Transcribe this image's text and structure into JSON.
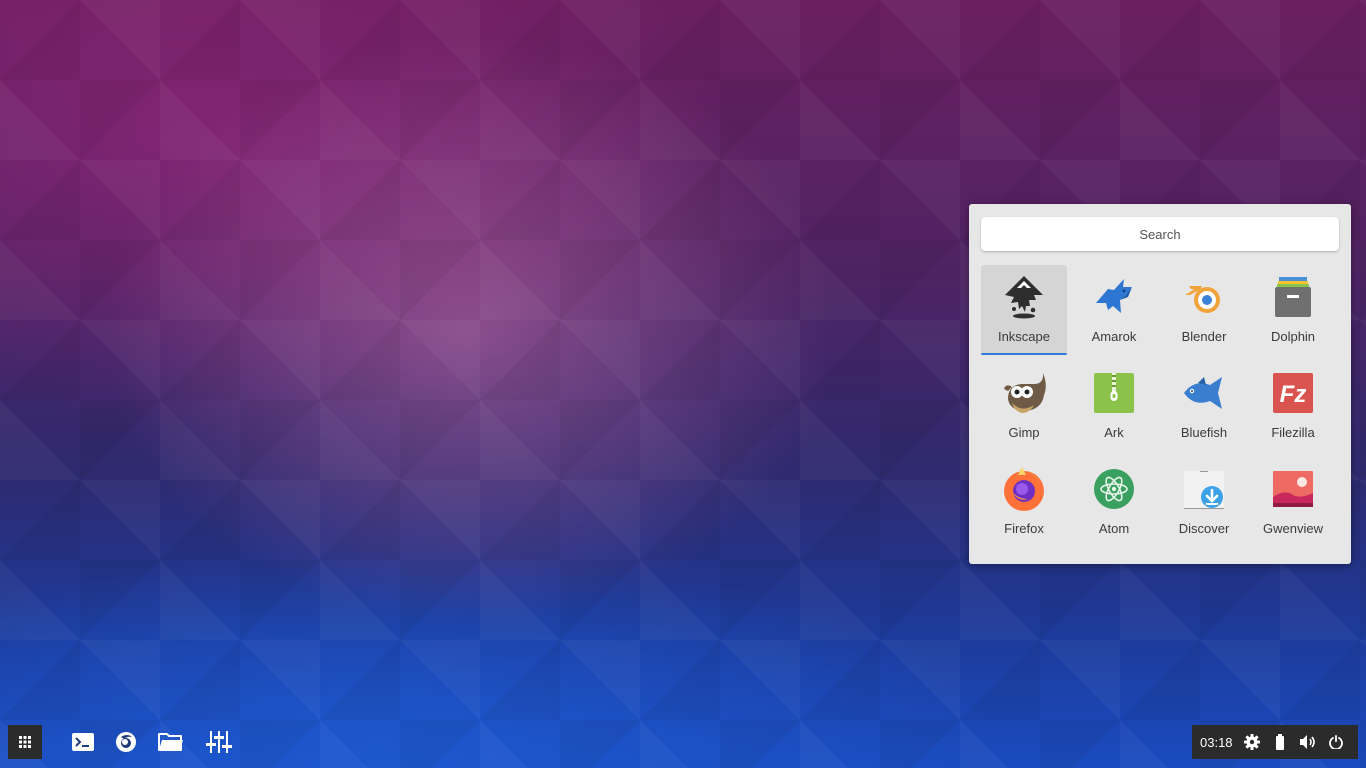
{
  "launcher": {
    "search_placeholder": "Search",
    "selected_app": "Inkscape",
    "accent_color": "#2f7dd6",
    "apps": [
      {
        "label": "Inkscape",
        "icon": "inkscape-icon"
      },
      {
        "label": "Amarok",
        "icon": "amarok-icon"
      },
      {
        "label": "Blender",
        "icon": "blender-icon"
      },
      {
        "label": "Dolphin",
        "icon": "dolphin-icon"
      },
      {
        "label": "Gimp",
        "icon": "gimp-icon"
      },
      {
        "label": "Ark",
        "icon": "ark-icon"
      },
      {
        "label": "Bluefish",
        "icon": "bluefish-icon"
      },
      {
        "label": "Filezilla",
        "icon": "filezilla-icon"
      },
      {
        "label": "Firefox",
        "icon": "firefox-icon"
      },
      {
        "label": "Atom",
        "icon": "atom-icon"
      },
      {
        "label": "Discover",
        "icon": "discover-icon"
      },
      {
        "label": "Gwenview",
        "icon": "gwenview-icon"
      }
    ]
  },
  "panel": {
    "start_icon": "app-grid-icon",
    "dock": [
      {
        "name": "terminal",
        "icon": "terminal-icon"
      },
      {
        "name": "firefox",
        "icon": "firefox-icon"
      },
      {
        "name": "file-manager",
        "icon": "folder-icon"
      },
      {
        "name": "settings",
        "icon": "sliders-icon"
      }
    ],
    "tray": {
      "clock": "03:18",
      "items": [
        "gear-icon",
        "battery-icon",
        "volume-icon",
        "power-icon"
      ]
    }
  }
}
